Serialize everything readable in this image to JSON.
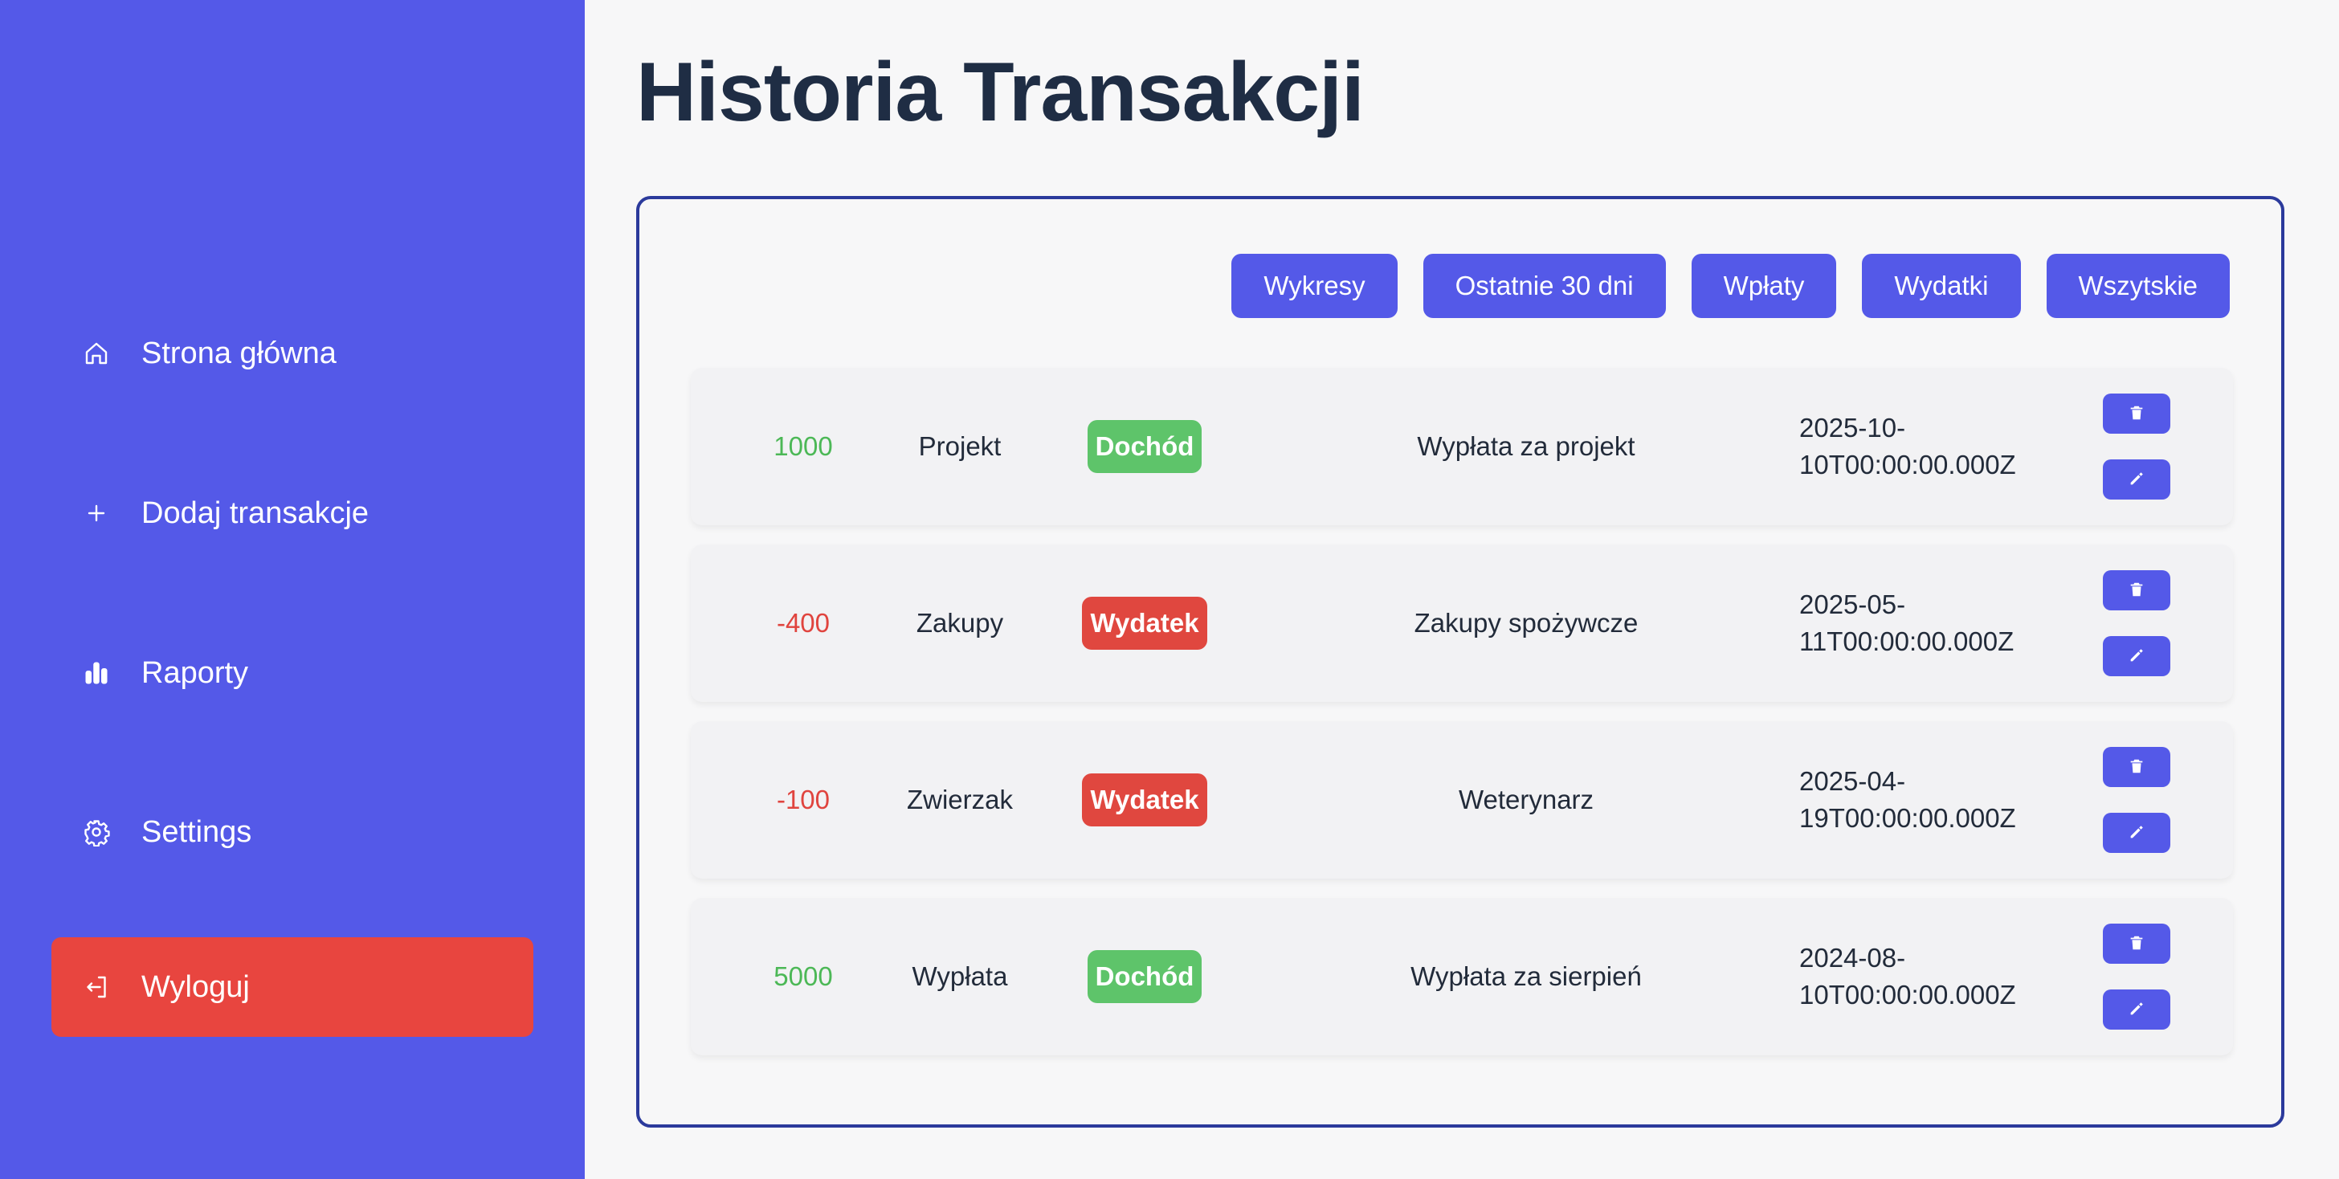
{
  "sidebar": {
    "items": [
      {
        "label": "Strona główna",
        "icon": "home-icon"
      },
      {
        "label": "Dodaj transakcje",
        "icon": "plus-icon"
      },
      {
        "label": "Raporty",
        "icon": "bar-chart-icon"
      },
      {
        "label": "Settings",
        "icon": "gear-icon"
      }
    ],
    "logout": {
      "label": "Wyloguj",
      "icon": "logout-icon"
    }
  },
  "main": {
    "title": "Historia Transakcji",
    "filters": [
      "Wykresy",
      "Ostatnie 30 dni",
      "Wpłaty",
      "Wydatki",
      "Wszytskie"
    ],
    "transactions": [
      {
        "amount": "1000",
        "category": "Projekt",
        "type": "Dochód",
        "description": "Wypłata za projekt",
        "date_line1": "2025-10-",
        "date_line2": "10T00:00:00.000Z"
      },
      {
        "amount": "-400",
        "category": "Zakupy",
        "type": "Wydatek",
        "description": "Zakupy spożywcze",
        "date_line1": "2025-05-",
        "date_line2": "11T00:00:00.000Z"
      },
      {
        "amount": "-100",
        "category": "Zwierzak",
        "type": "Wydatek",
        "description": "Weterynarz",
        "date_line1": "2025-04-",
        "date_line2": "19T00:00:00.000Z"
      },
      {
        "amount": "5000",
        "category": "Wypłata",
        "type": "Dochód",
        "description": "Wypłata za sierpień",
        "date_line1": "2024-08-",
        "date_line2": "10T00:00:00.000Z"
      }
    ]
  },
  "colors": {
    "sidebar_bg": "#5459e8",
    "logout_bg": "#e8453f",
    "income": "#5ec46a",
    "expense": "#e0473f",
    "title": "#1f2d44",
    "panel_border": "#2b3a9c"
  }
}
